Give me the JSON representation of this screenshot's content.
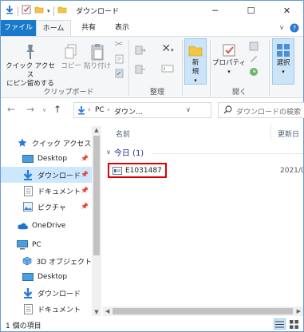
{
  "window": {
    "title": "ダウンロード",
    "minimize_icon": "minimize-icon",
    "maximize_icon": "maximize-icon",
    "close_icon": "close-icon"
  },
  "ribbon_tabs": [
    "ファイル",
    "ホーム",
    "共有",
    "表示"
  ],
  "ribbon": {
    "clipboard": {
      "pin_label_1": "クイック アクセス",
      "pin_label_2": "にピン留めする",
      "copy": "コピー",
      "paste": "貼り付け",
      "group_label": "クリップボード"
    },
    "organize": {
      "group_label": "整理"
    },
    "new": {
      "label_1": "新",
      "label_2": "規"
    },
    "open": {
      "properties": "プロパティ",
      "group_label": "開く"
    },
    "select": {
      "label": "選択"
    }
  },
  "address": {
    "path_pc": "PC",
    "path_sep": "›",
    "path_folder": "ダウン...",
    "search_placeholder": "ダウンロードの検索"
  },
  "nav_pane": {
    "quick_access": "クイック アクセス",
    "quick_items": [
      {
        "label": "Desktop",
        "pinned": true
      },
      {
        "label": "ダウンロード",
        "pinned": true,
        "selected": true
      },
      {
        "label": "ドキュメント",
        "pinned": true
      },
      {
        "label": "ピクチャ",
        "pinned": true
      }
    ],
    "onedrive": "OneDrive",
    "pc": "PC",
    "pc_items": [
      "3D オブジェクト",
      "Desktop",
      "ダウンロード",
      "ドキュメント"
    ]
  },
  "content": {
    "col_name": "名前",
    "col_date": "更新日",
    "group_label": "今日 (1)",
    "files": [
      {
        "name": "E1031487",
        "date": "2021/0"
      }
    ]
  },
  "status": {
    "text": "1 個の項目"
  }
}
